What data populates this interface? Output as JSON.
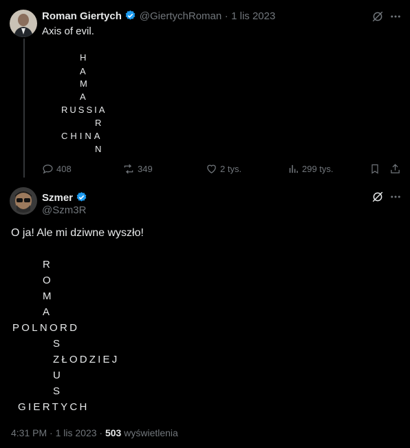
{
  "tweet1": {
    "name": "Roman Giertych",
    "handle": "@GiertychRoman",
    "sep": "·",
    "date": "1 lis 2023",
    "text": "Axis of evil.",
    "puzzle": {
      "h": "H",
      "a1": "A",
      "m": "M",
      "a2": "A",
      "russia": "RUSSIA",
      "r": "R",
      "china": "CHINA",
      "n": "N"
    },
    "stats": {
      "replies": "408",
      "reposts": "349",
      "likes": "2 tys.",
      "views": "299 tys."
    }
  },
  "tweet2": {
    "name": "Szmer",
    "handle": "@Szm3R",
    "text": "O ja! Ale mi dziwne wyszło!",
    "puzzle": {
      "r": "R",
      "o": "O",
      "m": "M",
      "a": "A",
      "polnord": "POLNORD",
      "s1": "S",
      "zlodziej": "ZŁODZIEJ",
      "u": "U",
      "s2": "S",
      "giertych": "GIERTYCH"
    },
    "time": "4:31 PM",
    "sep": "·",
    "date": "1 lis 2023",
    "views_count": "503",
    "views_label": "wyświetlenia"
  },
  "colors": {
    "verified": "#1d9bf0",
    "muted": "#71767b",
    "text": "#e7e9ea",
    "line": "#333639"
  },
  "icons": [
    "grok-icon",
    "more-icon",
    "reply-icon",
    "repost-icon",
    "like-icon",
    "views-icon",
    "bookmark-icon",
    "share-icon",
    "verified-badge-icon"
  ]
}
